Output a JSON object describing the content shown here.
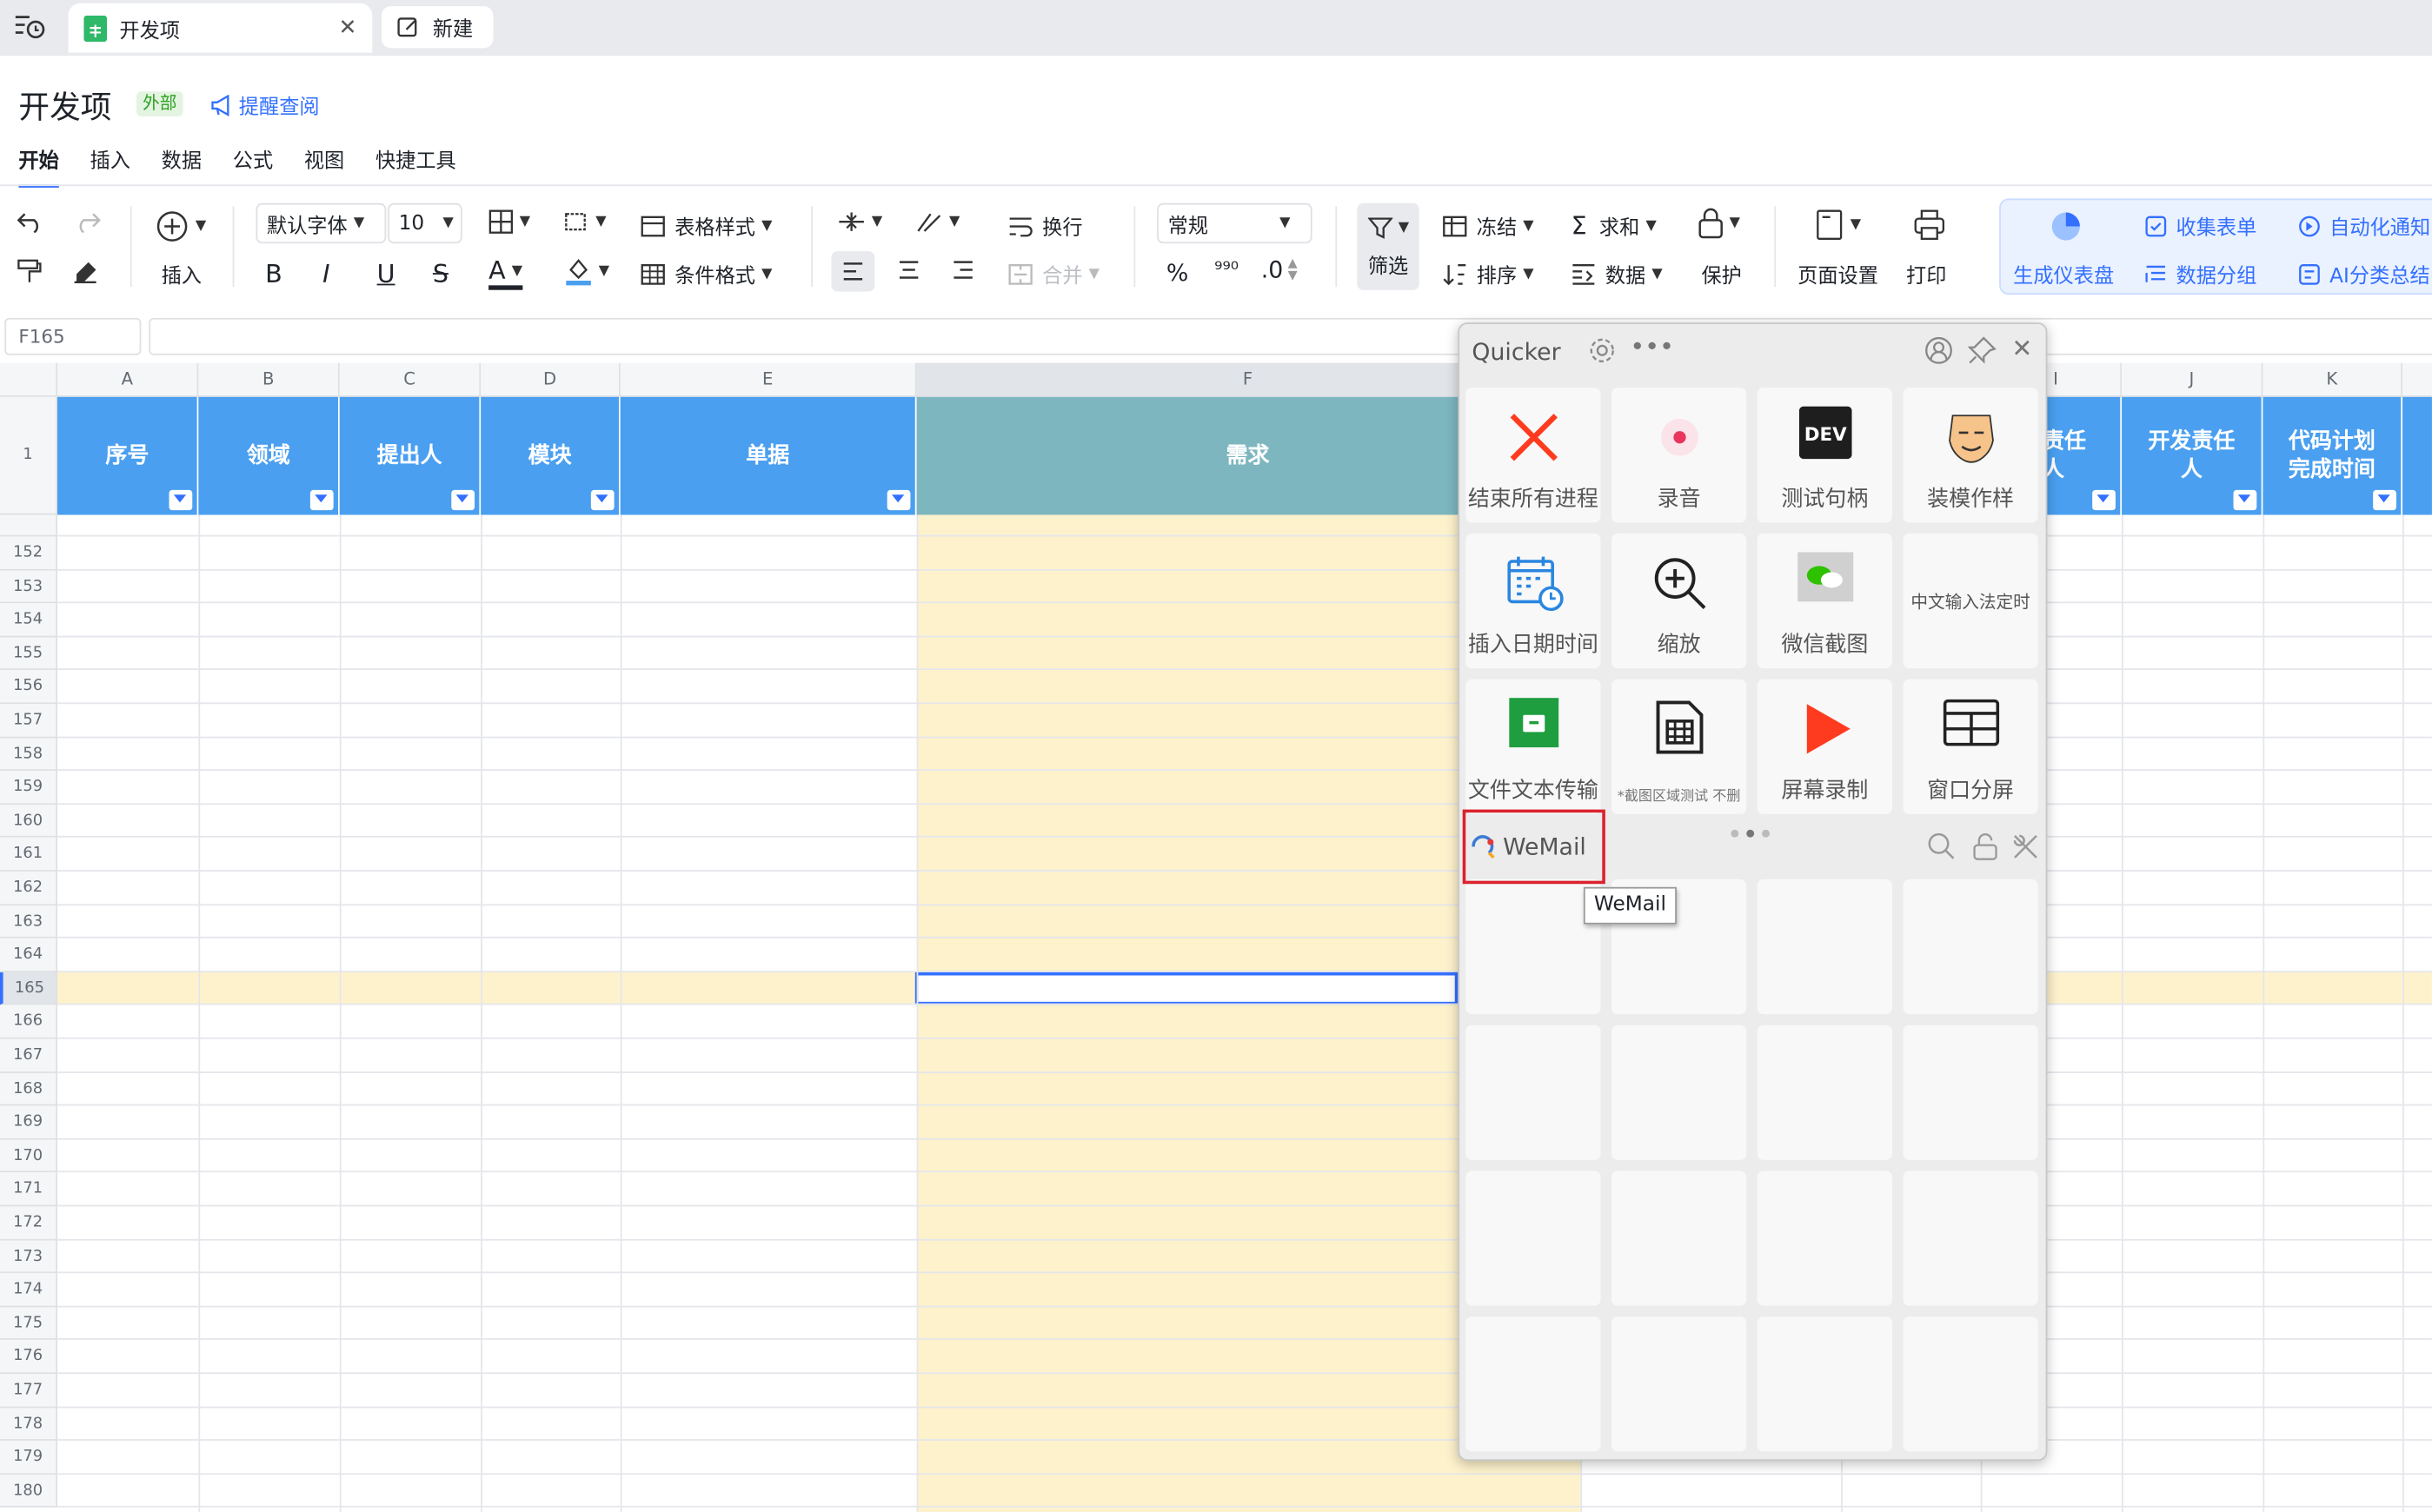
{
  "tabs": {
    "active_label": "开发项",
    "new_label": "新建"
  },
  "doc": {
    "title": "开发项",
    "badge": "外部",
    "remind": "提醒查阅"
  },
  "menu": [
    "开始",
    "插入",
    "数据",
    "公式",
    "视图",
    "快捷工具"
  ],
  "toolbar": {
    "insert": "插入",
    "font": "默认字体",
    "font_size": "10",
    "table_style": "表格样式",
    "cond_format": "条件格式",
    "wrap": "换行",
    "merge": "合并",
    "number_format": "常规",
    "filter": "筛选",
    "freeze": "冻结",
    "sort": "排序",
    "sum": "求和",
    "data": "数据",
    "protect": "保护",
    "page_setup": "页面设置",
    "print": "打印",
    "dashboard": "生成仪表盘",
    "collect_form": "收集表单",
    "data_group": "数据分组",
    "auto_notify": "自动化通知",
    "ai_summary": "AI分类总结",
    "percent": "%",
    "decimal": ".0"
  },
  "formula": {
    "cell_ref": "F165"
  },
  "columns": [
    "A",
    "B",
    "C",
    "D",
    "E",
    "F",
    "I",
    "J",
    "K"
  ],
  "header_row": {
    "num": "1",
    "cells": [
      "序号",
      "领域",
      "提出人",
      "模块",
      "单据",
      "需求",
      "责任人",
      "开发责任人",
      "代码计划完成时间"
    ]
  },
  "rows": [
    "152",
    "153",
    "154",
    "155",
    "156",
    "157",
    "158",
    "159",
    "160",
    "161",
    "162",
    "163",
    "164",
    "165",
    "166",
    "167",
    "168",
    "169",
    "170",
    "171",
    "172",
    "173",
    "174",
    "175",
    "176",
    "177",
    "178",
    "179",
    "180"
  ],
  "selected_row": "165",
  "quicker": {
    "title": "Quicker",
    "tiles": [
      "结束所有进程",
      "录音",
      "测试句柄",
      "装模作样",
      "插入日期时间",
      "缩放",
      "微信截图",
      "中文输入法定时",
      "文件文本传输",
      "*截图区域测试 不删",
      "屏幕录制",
      "窗口分屏"
    ],
    "dev_label": "DEV",
    "wemail": "WeMail",
    "tooltip": "WeMail"
  }
}
